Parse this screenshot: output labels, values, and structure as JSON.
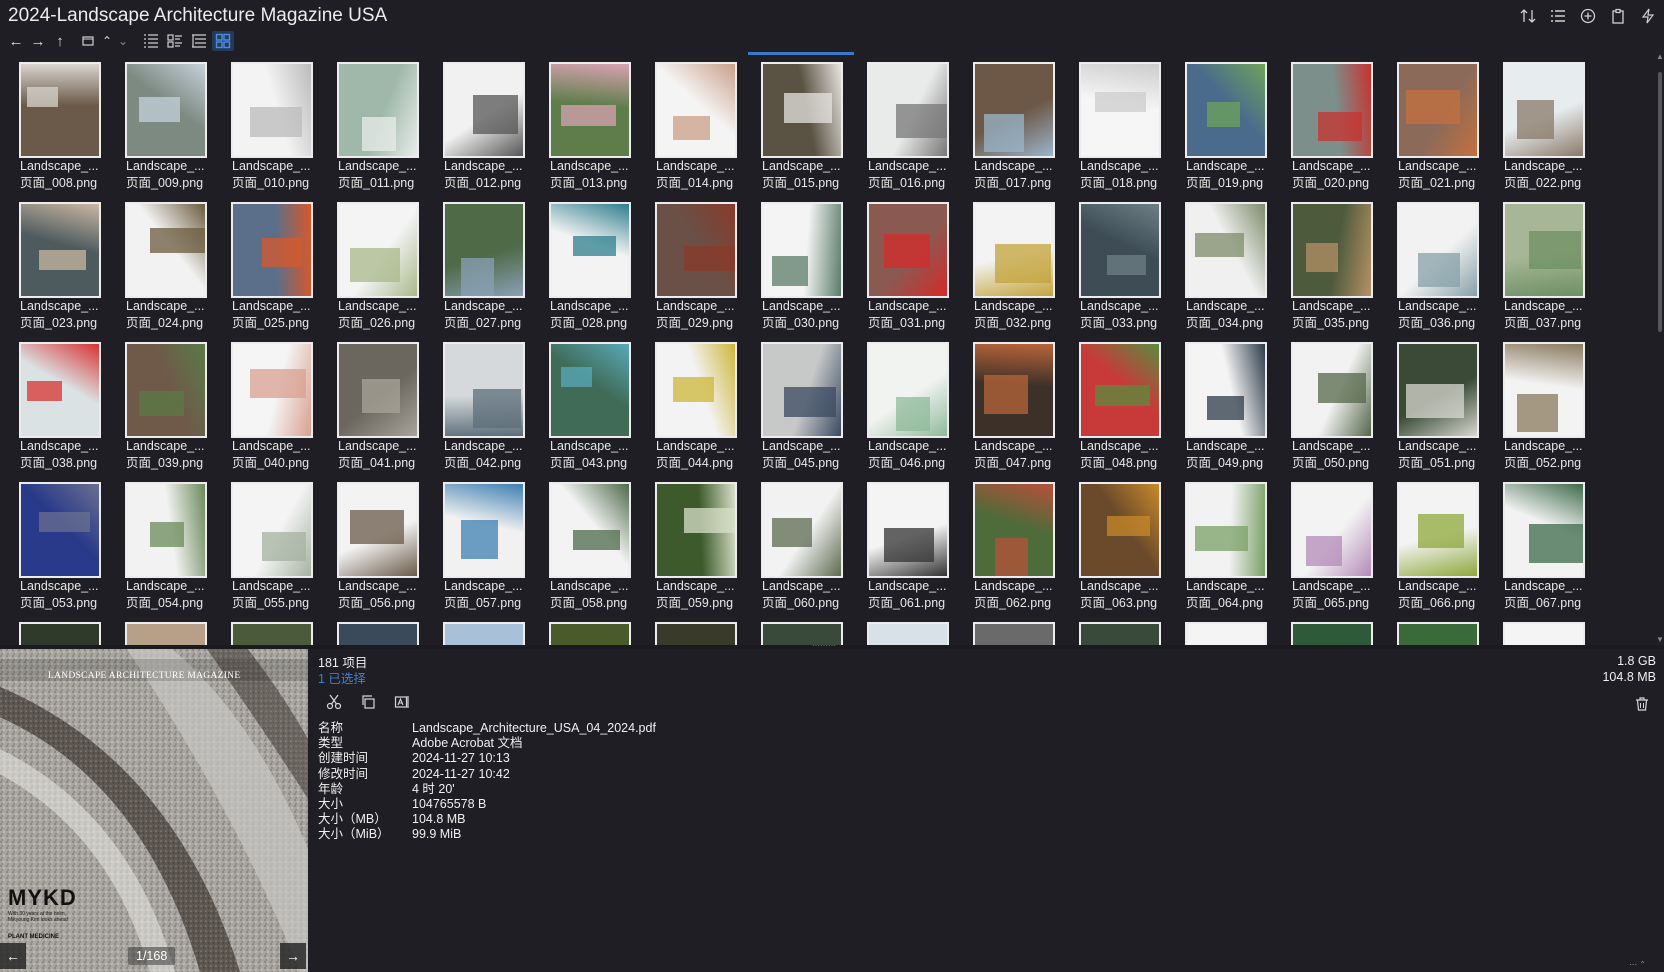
{
  "window": {
    "title": "2024-Landscape Architecture Magazine USA"
  },
  "toolbar_right": [
    {
      "icon": "sort-icon"
    },
    {
      "icon": "list-details-icon"
    },
    {
      "icon": "add-circle-icon"
    },
    {
      "icon": "clipboard-icon"
    },
    {
      "icon": "lightning-icon"
    }
  ],
  "navigation": {
    "back": "←",
    "forward": "→",
    "up": "↑",
    "drive": "▭",
    "caret_up": "⌃",
    "caret_down": "⌄"
  },
  "thumbnail_name_prefix": "Landscape_...",
  "thumbnails": [
    {
      "name2": "页面_008.png",
      "color": "#6b5a4a",
      "accent": "#d8d4ce"
    },
    {
      "name2": "页面_009.png",
      "color": "#7d8a82",
      "accent": "#c5d1d8"
    },
    {
      "name2": "页面_010.png",
      "color": "#f3f3f3",
      "accent": "#bbbbbb"
    },
    {
      "name2": "页面_011.png",
      "color": "#9fb8aa",
      "accent": "#e8ecea"
    },
    {
      "name2": "页面_012.png",
      "color": "#f1f1f1",
      "accent": "#555555"
    },
    {
      "name2": "页面_013.png",
      "color": "#5f7d4b",
      "accent": "#d6a3b2"
    },
    {
      "name2": "页面_014.png",
      "color": "#f4f4f4",
      "accent": "#caa08a"
    },
    {
      "name2": "页面_015.png",
      "color": "#5a5344",
      "accent": "#e6e3df"
    },
    {
      "name2": "页面_016.png",
      "color": "#e9eaea",
      "accent": "#777777"
    },
    {
      "name2": "页面_017.png",
      "color": "#6d5848",
      "accent": "#9ab5c9"
    },
    {
      "name2": "页面_018.png",
      "color": "#f6f6f6",
      "accent": "#cccccc"
    },
    {
      "name2": "页面_019.png",
      "color": "#4a6b8c",
      "accent": "#6ea35a"
    },
    {
      "name2": "页面_020.png",
      "color": "#7c8f8b",
      "accent": "#c8322f"
    },
    {
      "name2": "页面_021.png",
      "color": "#8b6a5a",
      "accent": "#c4703d"
    },
    {
      "name2": "页面_022.png",
      "color": "#e7ecef",
      "accent": "#8a7a68"
    },
    {
      "name2": "页面_023.png",
      "color": "#4d5a5e",
      "accent": "#c9b8a2"
    },
    {
      "name2": "页面_024.png",
      "color": "#f2f2f2",
      "accent": "#6b5b3d"
    },
    {
      "name2": "页面_025.png",
      "color": "#5c6f8a",
      "accent": "#d8582a"
    },
    {
      "name2": "页面_026.png",
      "color": "#f4f4f4",
      "accent": "#a9b88b"
    },
    {
      "name2": "页面_027.png",
      "color": "#4e6a47",
      "accent": "#8aa0b6"
    },
    {
      "name2": "页面_028.png",
      "color": "#f3f3f3",
      "accent": "#2e7f8e"
    },
    {
      "name2": "页面_029.png",
      "color": "#6a5046",
      "accent": "#8a3a2b"
    },
    {
      "name2": "页面_030.png",
      "color": "#f4f4f4",
      "accent": "#5b7c6a"
    },
    {
      "name2": "页面_031.png",
      "color": "#8a5a52",
      "accent": "#d42b2b"
    },
    {
      "name2": "页面_032.png",
      "color": "#f3f3f3",
      "accent": "#c3a33a"
    },
    {
      "name2": "页面_033.png",
      "color": "#3e4d55",
      "accent": "#6d7f86"
    },
    {
      "name2": "页面_034.png",
      "color": "#f0f0f0",
      "accent": "#7d8c6a"
    },
    {
      "name2": "页面_035.png",
      "color": "#4e5a3c",
      "accent": "#b49166"
    },
    {
      "name2": "页面_036.png",
      "color": "#f2f2f2",
      "accent": "#86a0a8"
    },
    {
      "name2": "页面_037.png",
      "color": "#a7b696",
      "accent": "#6d8f63"
    },
    {
      "name2": "页面_038.png",
      "color": "#dbe2e4",
      "accent": "#d83232"
    },
    {
      "name2": "页面_039.png",
      "color": "#6f5a4a",
      "accent": "#5a7b46"
    },
    {
      "name2": "页面_040.png",
      "color": "#f5f5f5",
      "accent": "#d8a091"
    },
    {
      "name2": "页面_041.png",
      "color": "#6b665e",
      "accent": "#a8a49a"
    },
    {
      "name2": "页面_042.png",
      "color": "#d5d9db",
      "accent": "#5c6d7a"
    },
    {
      "name2": "页面_043.png",
      "color": "#3f6b57",
      "accent": "#59a9b8"
    },
    {
      "name2": "页面_044.png",
      "color": "#f3f3f3",
      "accent": "#cdb73a"
    },
    {
      "name2": "页面_045.png",
      "color": "#c7c8c8",
      "accent": "#3a4a62"
    },
    {
      "name2": "页面_046.png",
      "color": "#f1f3f0",
      "accent": "#8fb99a"
    },
    {
      "name2": "页面_047.png",
      "color": "#3d3028",
      "accent": "#b7653a"
    },
    {
      "name2": "页面_048.png",
      "color": "#c83a3a",
      "accent": "#5b8c3e"
    },
    {
      "name2": "页面_049.png",
      "color": "#f4f4f4",
      "accent": "#2d3b4a"
    },
    {
      "name2": "页面_050.png",
      "color": "#f2f2f2",
      "accent": "#55674a"
    },
    {
      "name2": "页面_051.png",
      "color": "#3a4a37",
      "accent": "#d8d8d0"
    },
    {
      "name2": "页面_052.png",
      "color": "#f3f3f3",
      "accent": "#8a7a5e"
    },
    {
      "name2": "页面_053.png",
      "color": "#2a3a8a",
      "accent": "#6a7090"
    },
    {
      "name2": "页面_054.png",
      "color": "#f2f2f2",
      "accent": "#6b8a5a"
    },
    {
      "name2": "页面_055.png",
      "color": "#f4f4f4",
      "accent": "#a4b2a0"
    },
    {
      "name2": "页面_056.png",
      "color": "#f3f3f3",
      "accent": "#6a5a4a"
    },
    {
      "name2": "页面_057.png",
      "color": "#f1f1f1",
      "accent": "#3d7fb2"
    },
    {
      "name2": "页面_058.png",
      "color": "#f3f3f3",
      "accent": "#4e6a4a"
    },
    {
      "name2": "页面_059.png",
      "color": "#3c5a2c",
      "accent": "#d8e0c8"
    },
    {
      "name2": "页面_060.png",
      "color": "#f2f2f2",
      "accent": "#5e6a50"
    },
    {
      "name2": "页面_061.png",
      "color": "#f4f4f4",
      "accent": "#333333"
    },
    {
      "name2": "页面_062.png",
      "color": "#4e6b3a",
      "accent": "#b8503a"
    },
    {
      "name2": "页面_063.png",
      "color": "#6a4a2a",
      "accent": "#c88a2a"
    },
    {
      "name2": "页面_064.png",
      "color": "#f2f2f2",
      "accent": "#7aa066"
    },
    {
      "name2": "页面_065.png",
      "color": "#f3f3f3",
      "accent": "#b48ab8"
    },
    {
      "name2": "页面_066.png",
      "color": "#f3f3f3",
      "accent": "#8ea83a"
    },
    {
      "name2": "页面_067.png",
      "color": "#f2f2f2",
      "accent": "#3e6a4a"
    }
  ],
  "partial_row_colors": [
    "#2f3a2a",
    "#b8a088",
    "#4a5a3a",
    "#3a4a5a",
    "#a8c0d8",
    "#4a5a2a",
    "#3a3a2a",
    "#3a4a3a",
    "#d8e0e8",
    "#6a6a6a",
    "#3a4a3a",
    "#f4f4f4",
    "#2f5a3a",
    "#3a6a3a",
    "#f4f4f4"
  ],
  "preview": {
    "magazine_title": "LANDSCAPE ARCHITECTURE MAGAZINE",
    "cover_brand": "MYKD",
    "cover_small": "With 30 years at the helm, Mikyoung Kim looks ahead",
    "cover_plant": "PLANT MEDICINE",
    "page_indicator": "1/168"
  },
  "info": {
    "item_count": "181 项目",
    "selected": "1 已选择",
    "total_size": "1.8 GB",
    "selected_size": "104.8 MB",
    "properties": [
      {
        "key": "名称",
        "value": "Landscape_Architecture_USA_04_2024.pdf"
      },
      {
        "key": "类型",
        "value": "Adobe Acrobat 文档"
      },
      {
        "key": "创建时间",
        "value": "2024-11-27  10:13"
      },
      {
        "key": "修改时间",
        "value": "2024-11-27  10:42"
      },
      {
        "key": "年龄",
        "value": "4 时 20'"
      },
      {
        "key": "大小",
        "value": "104765578 B"
      },
      {
        "key": "大小（MB）",
        "value": "104.8 MB"
      },
      {
        "key": "大小（MiB）",
        "value": "99.9 MiB"
      }
    ]
  }
}
